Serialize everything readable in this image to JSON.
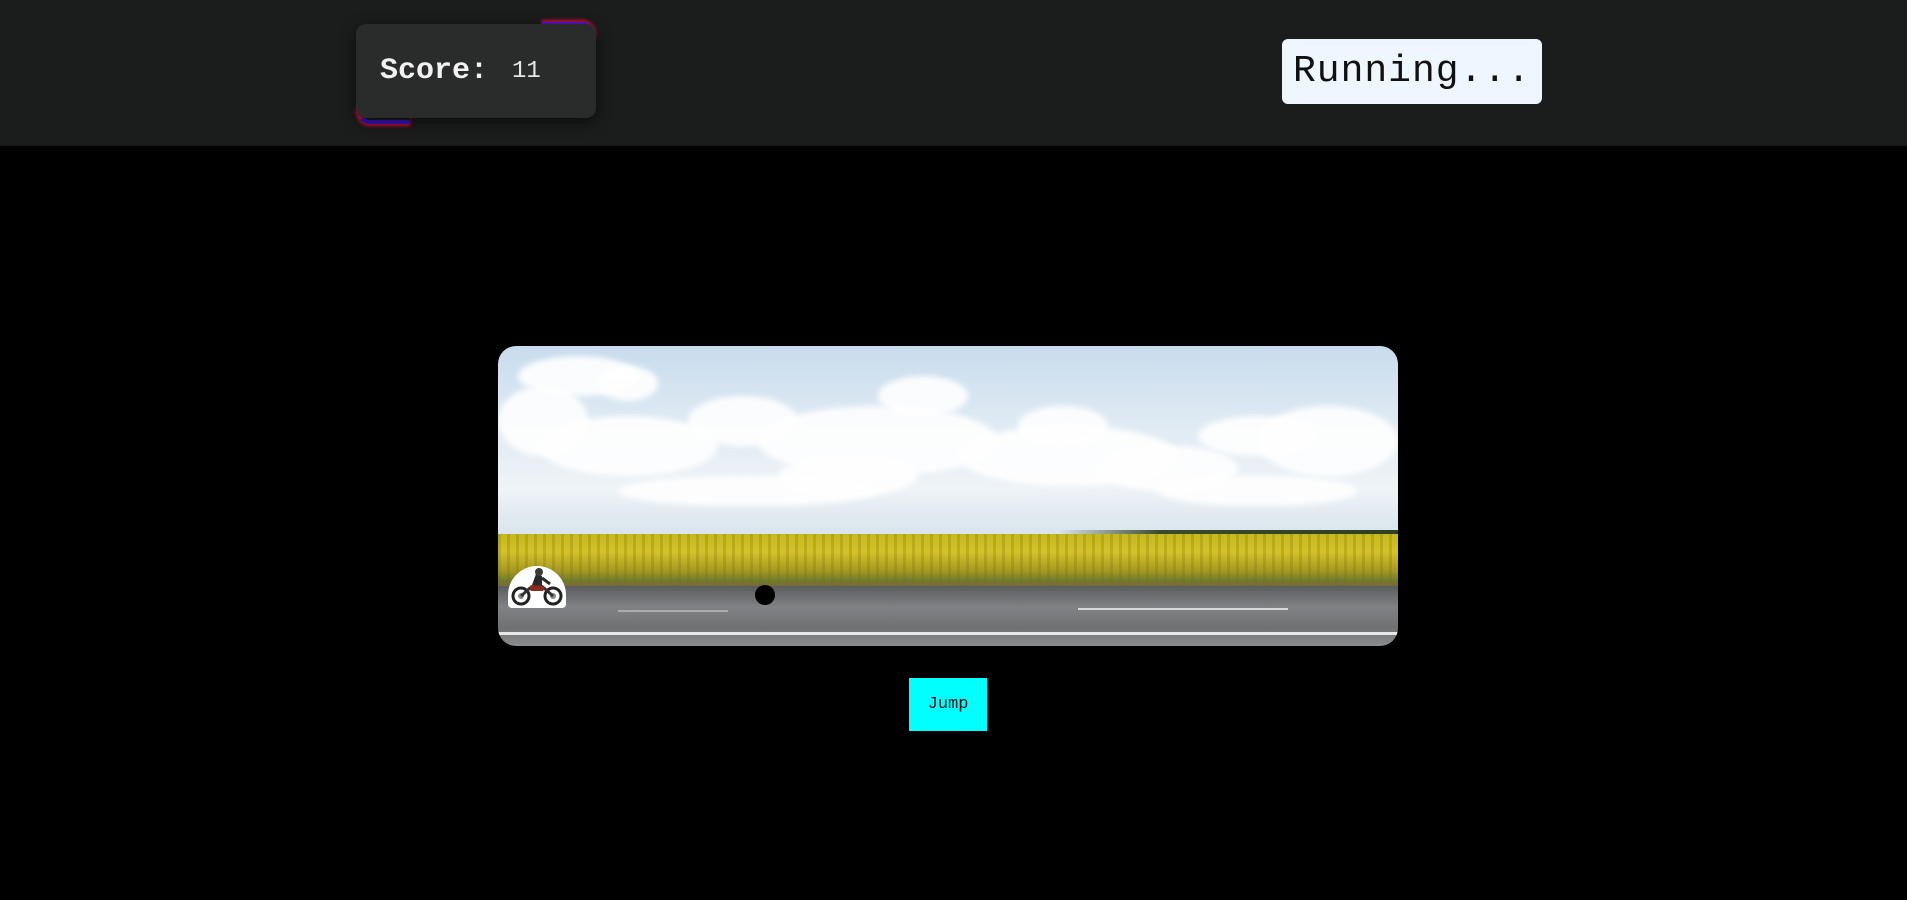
{
  "header": {
    "score_label": "Score:",
    "score_value": "11",
    "status": "Running..."
  },
  "game": {
    "player_icon": "motorcycle-rider-icon",
    "obstacle_icon": "ball-obstacle-icon",
    "scene": "sunflower-field-road-background"
  },
  "controls": {
    "jump_label": "Jump"
  },
  "colors": {
    "topbar": "#1b1c1c",
    "score_panel": "#2a2b2b",
    "status_panel": "#eef6ff",
    "jump_button": "#00ffff",
    "page_background": "#000000"
  }
}
